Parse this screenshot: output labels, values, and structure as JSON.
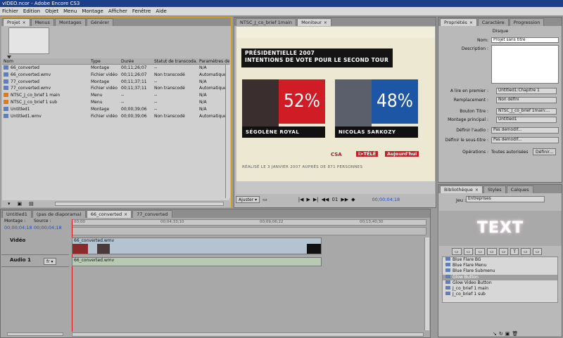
{
  "window": {
    "title": "vIDEO.ncor - Adobe Encore CS3"
  },
  "menu": [
    "Fichier",
    "Edition",
    "Objet",
    "Menu",
    "Montage",
    "Afficher",
    "Fenêtre",
    "Aide"
  ],
  "project_panel": {
    "tabs": [
      "Projet",
      "Menus",
      "Montages",
      "Générer"
    ],
    "columns": [
      "Nom",
      "Type",
      "Durée",
      "Statut de transcoda...",
      "Paramètres de tr"
    ],
    "rows": [
      {
        "name": "66_converted",
        "type": "Montage",
        "duree": "00;11;26;07",
        "statut": "--",
        "param": "N/A",
        "icon": "timeline-icon"
      },
      {
        "name": "66_converted.wmv",
        "type": "Fichier vidéo",
        "duree": "00;11;26;07",
        "statut": "Non transcodé",
        "param": "Automatique",
        "icon": "video-file-icon"
      },
      {
        "name": "77_converted",
        "type": "Montage",
        "duree": "00;11;37;11",
        "statut": "--",
        "param": "N/A",
        "icon": "timeline-icon"
      },
      {
        "name": "77_converted.wmv",
        "type": "Fichier vidéo",
        "duree": "00;11;37;11",
        "statut": "Non transcodé",
        "param": "Automatique",
        "icon": "video-file-icon"
      },
      {
        "name": "NTSC_J_co_brief 1 main",
        "type": "Menu",
        "duree": "--",
        "statut": "--",
        "param": "N/A",
        "icon": "menu-icon"
      },
      {
        "name": "NTSC_J_co_brief 1 sub",
        "type": "Menu",
        "duree": "--",
        "statut": "--",
        "param": "N/A",
        "icon": "menu-icon"
      },
      {
        "name": "Untitled1",
        "type": "Montage",
        "duree": "00;00;39;06",
        "statut": "--",
        "param": "N/A",
        "icon": "timeline-icon"
      },
      {
        "name": "Untitled1.wmv",
        "type": "Fichier vidéo",
        "duree": "00;00;39;06",
        "statut": "Non transcodé",
        "param": "Automatique",
        "icon": "video-file-icon"
      }
    ]
  },
  "monitor_panel": {
    "tabs": [
      "NTSC_J_co_brief 1main",
      "Moniteur"
    ],
    "frame": {
      "title_line1": "PRÉSIDENTIELLE 2007",
      "title_line2": "INTENTIONS DE VOTE POUR LE SECOND TOUR",
      "candidate1": {
        "name": "SÉGOLÈNE ROYAL",
        "pct": "52%",
        "color": "#d01c24"
      },
      "candidate2": {
        "name": "NICOLAS SARKOZY",
        "pct": "48%",
        "color": "#1d56a5"
      },
      "logos": [
        "CSA",
        "i>TÉLÉ",
        "Aujourd'hui"
      ],
      "note": "RÉALISÉ LE 3 JANVIER 2007 AUPRÈS DE 871 PERSONNES"
    },
    "fit_label": "Ajuster",
    "chapter": "01",
    "timecode": "00;00;04;18"
  },
  "properties_panel": {
    "tabs": [
      "Propriétés",
      "Caractère",
      "Progression"
    ],
    "heading": "Disque",
    "fields": [
      {
        "label": "Nom:",
        "value": "Projet sans titre"
      },
      {
        "label": "Description :",
        "value": ""
      }
    ],
    "dropdowns": [
      {
        "label": "A lire en premier :",
        "value": "Untitled1:Chapitre 1"
      },
      {
        "label": "Remplacement :",
        "value": "Non défini"
      },
      {
        "label": "Bouton Titre :",
        "value": "NTSC_J_co_brief 1main:..."
      },
      {
        "label": "Montage principal :",
        "value": "Untitled1"
      },
      {
        "label": "Définir l'audio :",
        "value": "Pas demodif..."
      },
      {
        "label": "Définir le sous-titre :",
        "value": "Pas demodif..."
      }
    ],
    "operations_label": "Opérations :",
    "operations_value": "Toutes autorisées",
    "define_button": "Définir..."
  },
  "library_panel": {
    "tabs": [
      "Bibliothèque",
      "Styles",
      "Calques"
    ],
    "set_label": "Jeu :",
    "set_value": "Entreprises",
    "preview_text": "TEXT",
    "items": [
      "Blue Flare BG",
      "Blue Flare Menu",
      "Blue Flare Submenu",
      "Glow Button",
      "Glow Video Button",
      "J_co_brief 1 main",
      "J_co_brief 1 sub"
    ],
    "selected_index": 3
  },
  "timeline_panel": {
    "tabs": [
      "Untitled1",
      "(pas de diaporama)",
      "66_converted",
      "77_converted"
    ],
    "montage_label": "Montage :",
    "source_label": "Source :",
    "montage_tc": "00;00;04;18",
    "source_tc": "00;00;04;18",
    "ruler_marks": [
      "00;00",
      "00;04;33;10",
      "00;09;06;22",
      "00;13;40;30"
    ],
    "tracks": {
      "video_label": "Vidéo",
      "video_clip": "66_converted.wmv",
      "audio_label": "Audio 1",
      "audio_lang": "fr",
      "audio_clip": "66_converted.wmv"
    }
  }
}
